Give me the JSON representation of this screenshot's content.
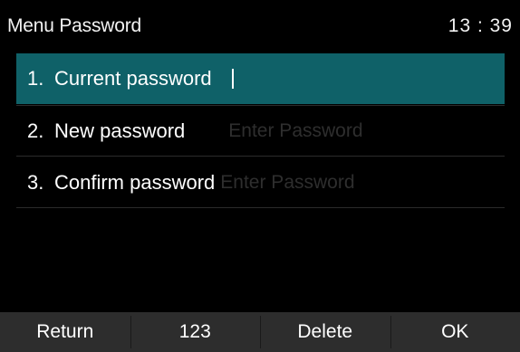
{
  "header": {
    "title": "Menu Password",
    "time": "13 : 39"
  },
  "rows": [
    {
      "number": "1.",
      "label": "Current password",
      "value": "",
      "placeholder": "",
      "selected": true
    },
    {
      "number": "2.",
      "label": "New password",
      "value": "",
      "placeholder": "Enter Password",
      "selected": false
    },
    {
      "number": "3.",
      "label": "Confirm password",
      "value": "",
      "placeholder": "Enter Password",
      "selected": false
    }
  ],
  "softkeys": [
    "Return",
    "123",
    "Delete",
    "OK"
  ],
  "colors": {
    "selection": "#0f6168",
    "softkey_bar": "#2d2d2d",
    "placeholder": "#2e2e2e",
    "background": "#000000"
  }
}
